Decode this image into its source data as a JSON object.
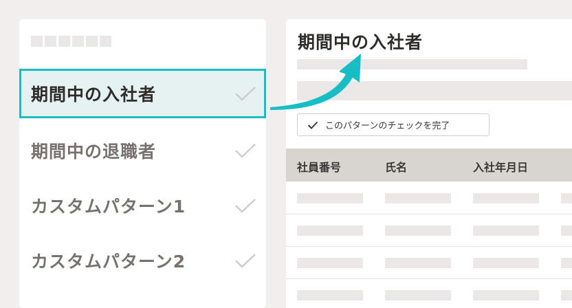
{
  "sidebar": {
    "items": [
      {
        "label": "期間中の入社者",
        "active": true
      },
      {
        "label": "期間中の退職者",
        "active": false
      },
      {
        "label": "カスタムパターン1",
        "active": false
      },
      {
        "label": "カスタムパターン2",
        "active": false
      }
    ]
  },
  "main": {
    "title": "期間中の入社者",
    "complete_button_label": "このパターンのチェックを完了",
    "table": {
      "columns": [
        "社員番号",
        "氏名",
        "入社年月日"
      ]
    }
  },
  "colors": {
    "accent": "#18bec6",
    "active_bg": "#e6f1f2",
    "header_bg": "#d9d6d2",
    "page_bg": "#f1f0ee"
  },
  "icons": [
    "check-icon",
    "arrow-icon"
  ]
}
